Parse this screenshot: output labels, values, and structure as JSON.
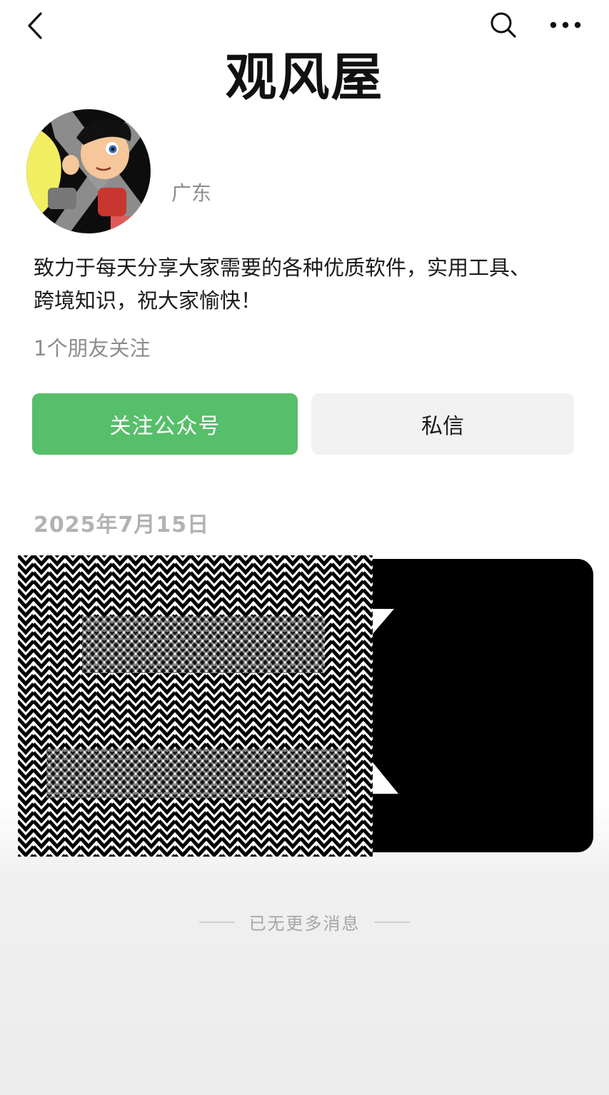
{
  "header": {
    "back_icon": "chevron-left-icon",
    "search_icon": "search-icon",
    "more_icon": "more-dots-icon"
  },
  "profile": {
    "name": "观风屋",
    "location": "广东",
    "bio_line1": "致力于每天分享大家需要的各种优质软件，实用工具、",
    "bio_line2": "跨境知识，祝大家愉快！",
    "followers": "1个朋友关注"
  },
  "actions": {
    "follow_label": "关注公众号",
    "message_label": "私信",
    "follow_color": "#57be6a"
  },
  "feed": {
    "date": "2025年7月15日",
    "end_note": "已无更多消息"
  }
}
